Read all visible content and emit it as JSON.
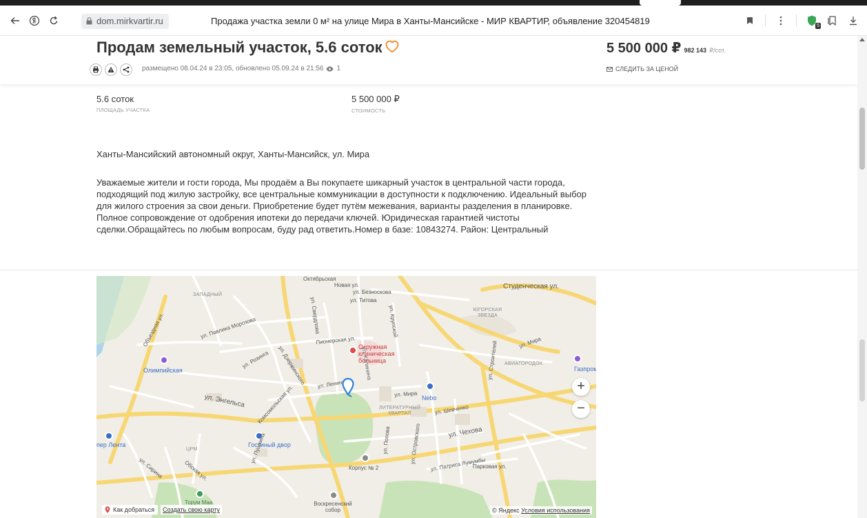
{
  "browser": {
    "domain": "dom.mirkvartir.ru",
    "page_title": "Продажа участка земли 0 м² на улице Мира в Ханты-Мансийске - МИР КВАРТИР, объявление 320454819",
    "extension_badge": "5"
  },
  "header": {
    "title": "Продам земельный участок, 5.6 соток",
    "meta": "размещено 08.04.24 в 23:05, обновлено 05.09.24 в 21:56",
    "views": "1",
    "price": "5 500 000 ₽",
    "price_per_unit": "982 143",
    "price_per_unit_suffix": "₽/сот.",
    "follow_price": "СЛЕДИТЬ ЗА ЦЕНОЙ"
  },
  "params": [
    {
      "value": "5.6 соток",
      "label": "ПЛОЩАДЬ УЧАСТКА"
    },
    {
      "value": "5 500 000 ₽",
      "label": "СТОИМОСТЬ"
    }
  ],
  "address": "Ханты-Мансийский автономный округ, Ханты-Мансийск, ул. Мира",
  "description": "Уважаемые жители и гости города, Мы продаём а Вы покупаете шикарный участок в центральной части города, подходящий под жилую застройку, все центральные коммуникации в доступности к подключению. Идеальный выбор для жилого строения за свои деньги. Приобретение будет путём межевания, варианты разделения в планировке. Полное сопровождение от одобрения ипотеки до передачи ключей. Юридическая гарантией чистоты сделки.Обращайтесь по любым вопросам, буду рад ответить.Номер в базе: 10843274. Район: Центральный",
  "map": {
    "labels": {
      "zapadny": "ЗАПАДНЫЙ",
      "oktyabrskaya": "Октябрьская",
      "novaya": "Новая ул.",
      "beznosova": "ул. Безноскова",
      "titova": "ул. Титова",
      "studencheskaya": "Студенческая ул.",
      "ugorskaya": "ЮГОРСКАЯ ЗВЕЗДА",
      "obezdnaya": "Объездная ул.",
      "morozova": "ул. Павлика Морозова",
      "pionerskaya": "Пионерская ул.",
      "rozinga": "ул. Розинга",
      "dzerzhinskogo": "ул. Дзержинского",
      "kalinina": "ул. Калинина",
      "stroiteley": "ул. Строителей",
      "mira_ne": "ул. Мира",
      "mira": "ул. Мира",
      "aviagorodok": "АВИАГОРОДОК",
      "gazprom": "Газпромнеф",
      "olimpiyskaya": "Олимпийская",
      "lenina": "ул. Ленина",
      "engelsa": "ул. Энгельса",
      "komsomolskaya": "Комсомольская ул.",
      "nebo": "Nebo",
      "shevchenko": "ул. Шевченко",
      "literaturny": "ЛИТЕРАТУРНЫЙ КВАРТАЛ",
      "chekhova": "ул. Чехова",
      "lenta": "пер Лента",
      "sirina": "ул. Сирина",
      "crm": "ЦРМ",
      "gostiny": "Гостиный двор",
      "obskaya": "Обская ул.",
      "pushkina": "ул. Пушкина",
      "popova": "ул. Попова",
      "ostrovskogo": "ул. Островского",
      "lumumby": "ул. Патриса Лумумбы",
      "parkovaya": "Парковая ул.",
      "korpus": "Корпус № 2",
      "torum": "Торум Маа",
      "voskresensky": "Воскресенский собор",
      "hospital": "Окружная клиническая больница",
      "svedrova": "ул. Свердлова",
      "krupskoy": "ул. Крупской"
    },
    "route_btn": "Как добраться",
    "create_map": "Создать свою карту",
    "copyright": "© Яндекс",
    "terms": "Условия использования",
    "zoom_in": "+",
    "zoom_out": "−"
  }
}
